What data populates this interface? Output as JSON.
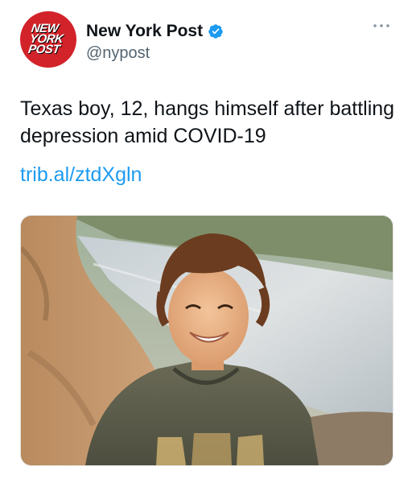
{
  "tweet": {
    "author": {
      "display_name": "New York Post",
      "handle": "@nypost",
      "verified": true,
      "avatar_logo_lines": [
        "NEW",
        "YORK",
        "POST"
      ],
      "avatar_color": "#d2232a"
    },
    "text": "Texas boy, 12, hangs himself after battling depression amid COVID-19",
    "link": "trib.al/ztdXgln",
    "media_icon": "photo-of-smiling-boy-by-river"
  },
  "colors": {
    "link": "#1d9bf0",
    "verified": "#1d9bf0",
    "secondary_text": "#536471"
  }
}
